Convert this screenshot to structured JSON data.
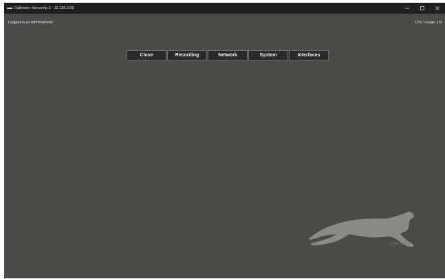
{
  "window": {
    "title": "Dallmeier Netconfig 3 - 10.128.3.66"
  },
  "status": {
    "login": "Logged in as Administrator",
    "cpu": "CPU Usage: 1%"
  },
  "menu": {
    "items": [
      {
        "label": "Close"
      },
      {
        "label": "Recording"
      },
      {
        "label": "Network"
      },
      {
        "label": "System"
      },
      {
        "label": "Interfaces"
      }
    ]
  },
  "brand": {
    "tagline": "See more."
  },
  "colors": {
    "background": "#4a4a48",
    "titlebar": "#1f1f1f",
    "button": "#2a2a2a",
    "logo": "#8a8a88"
  },
  "icons": {
    "app": "app-icon",
    "minimize": "minimize-icon",
    "maximize": "maximize-icon",
    "close": "close-icon",
    "logo": "cheetah-logo-icon"
  }
}
